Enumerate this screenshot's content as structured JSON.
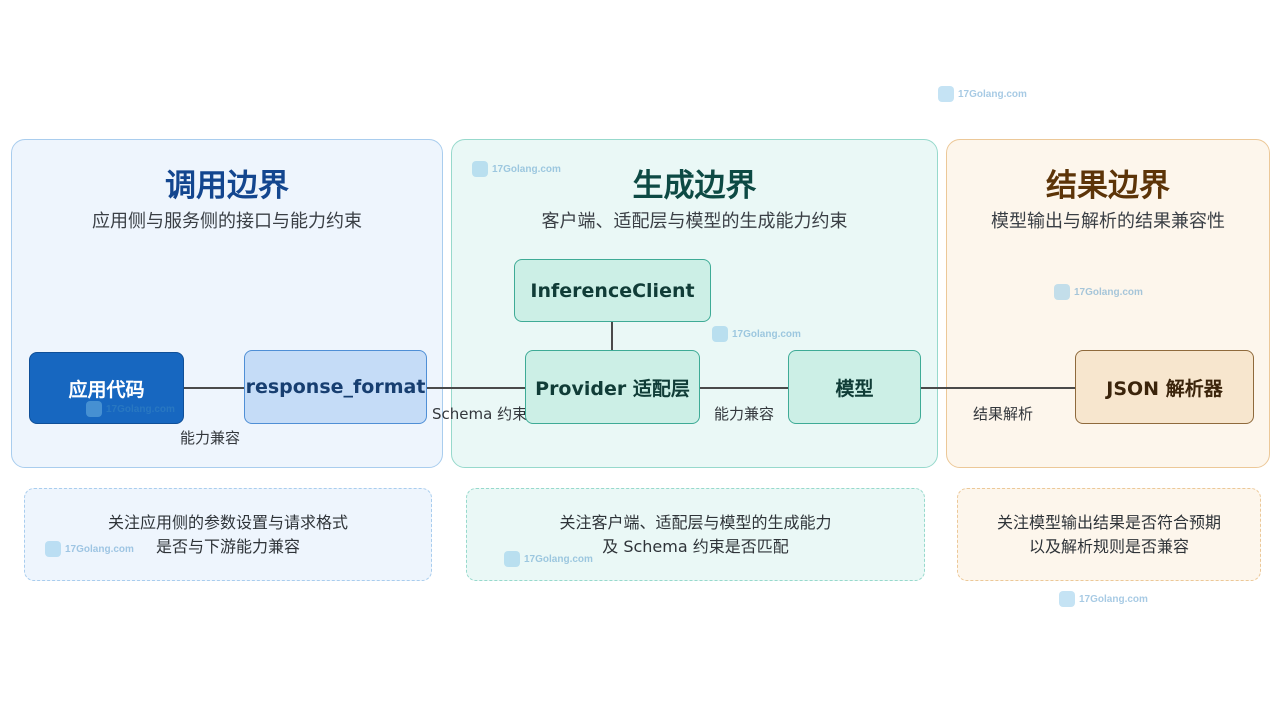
{
  "panels": {
    "call": {
      "title": "调用边界",
      "subtitle": "应用侧与服务侧的接口与能力约束",
      "note_lines": [
        "关注应用侧的参数设置与请求格式",
        "是否与下游能力兼容"
      ]
    },
    "gen": {
      "title": "生成边界",
      "subtitle": "客户端、适配层与模型的生成能力约束",
      "note_lines": [
        "关注客户端、适配层与模型的生成能力",
        "及 Schema 约束是否匹配"
      ]
    },
    "result": {
      "title": "结果边界",
      "subtitle": "模型输出与解析的结果兼容性",
      "note_lines": [
        "关注模型输出结果是否符合预期",
        "以及解析规则是否兼容"
      ]
    }
  },
  "nodes": {
    "app_code": "应用代码",
    "response_format": "response_format",
    "inference_client": "InferenceClient",
    "provider_adapter": "Provider 适配层",
    "model": "模型",
    "json_parser": "JSON 解析器"
  },
  "edges": {
    "app_to_resp": "能力兼容",
    "resp_to_provider": "Schema 约束",
    "provider_to_model": "能力兼容",
    "model_to_parser": "结果解析"
  },
  "watermark": "17Golang.com"
}
